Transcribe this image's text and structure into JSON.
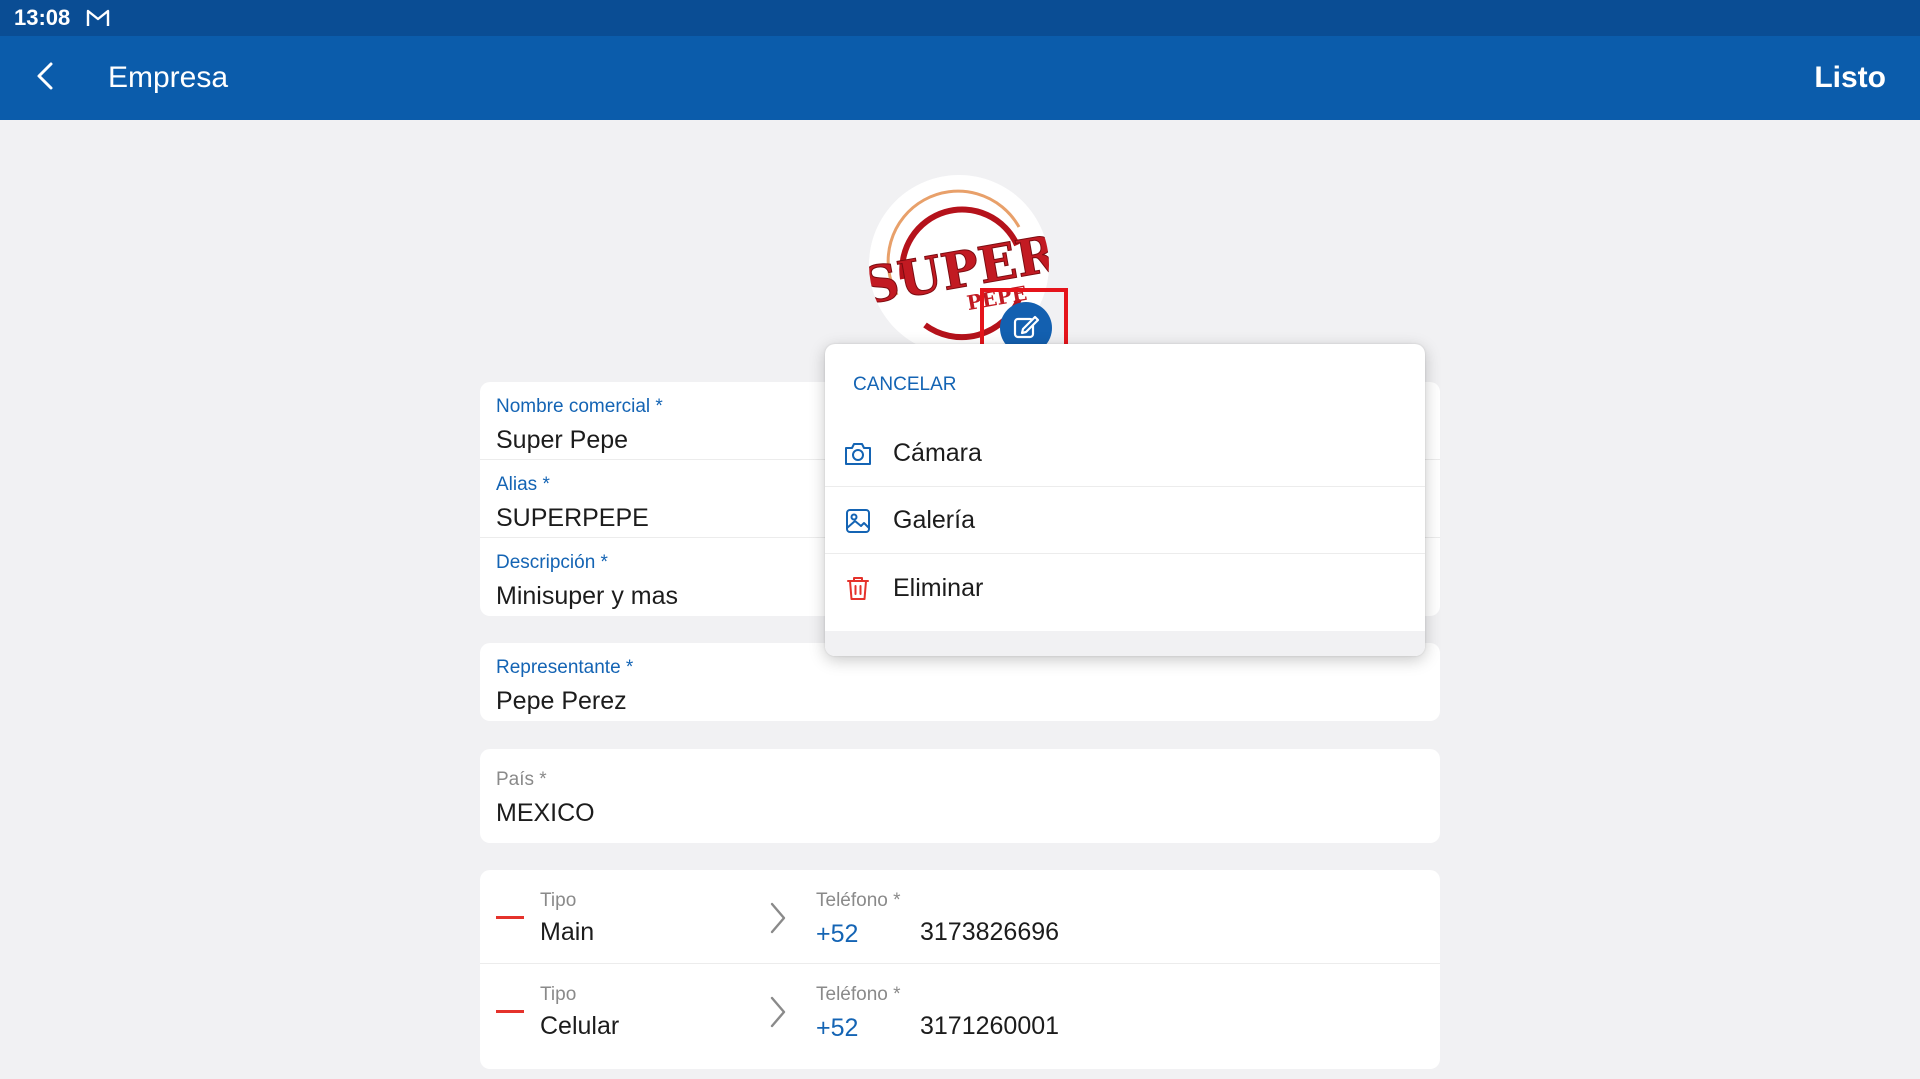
{
  "status_bar": {
    "time": "13:08"
  },
  "app_bar": {
    "title": "Empresa",
    "done_label": "Listo"
  },
  "logo": {
    "line1": "SUPER",
    "line2": "PEPE"
  },
  "company_card": {
    "nombre_label": "Nombre comercial *",
    "nombre_value": "Super Pepe",
    "alias_label": "Alias *",
    "alias_value": "SUPERPEPE",
    "descripcion_label": "Descripción *",
    "descripcion_value": "Minisuper y mas"
  },
  "rep_card": {
    "label": "Representante *",
    "value": "Pepe Perez"
  },
  "country_card": {
    "label": "País *",
    "value": "MEXICO"
  },
  "phones": [
    {
      "tipo_label": "Tipo",
      "tipo_value": "Main",
      "tel_label": "Teléfono *",
      "code": "+52",
      "number": "3173826696"
    },
    {
      "tipo_label": "Tipo",
      "tipo_value": "Celular",
      "tel_label": "Teléfono *",
      "code": "+52",
      "number": "3171260001"
    }
  ],
  "sheet": {
    "cancel_label": "CANCELAR",
    "items": [
      {
        "label": "Cámara",
        "icon": "camera-icon"
      },
      {
        "label": "Galería",
        "icon": "gallery-icon"
      },
      {
        "label": "Eliminar",
        "icon": "trash-icon"
      }
    ]
  },
  "colors": {
    "status_bar": "#0a4d94",
    "app_bar": "#0b5cab",
    "accent": "#1464b4",
    "danger": "#e5322b",
    "logo_red": "#b5121b",
    "highlight": "#e5141b"
  }
}
